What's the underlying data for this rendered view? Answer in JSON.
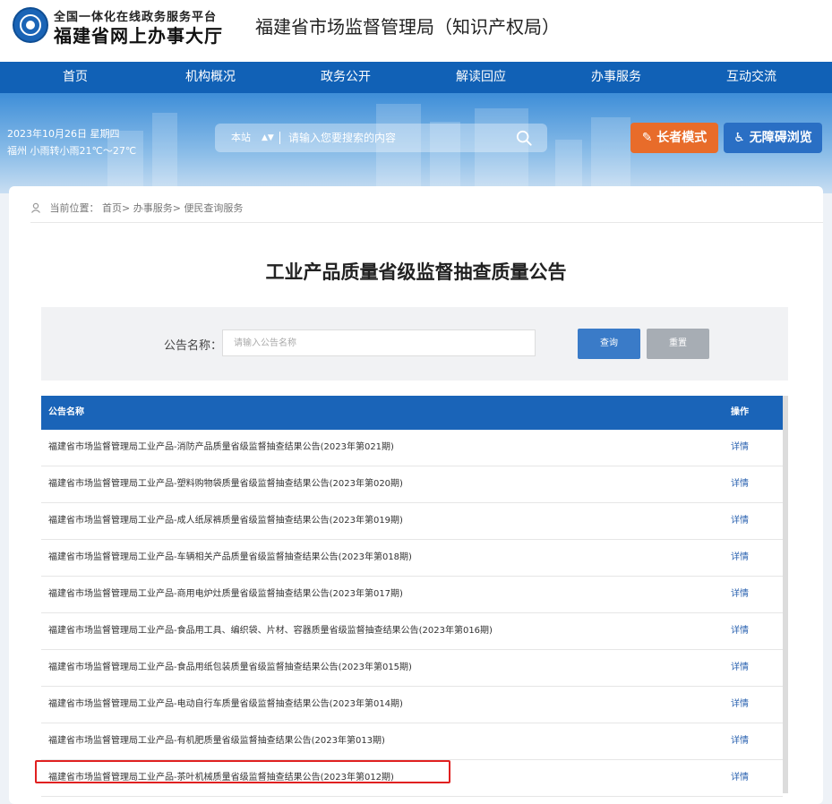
{
  "header": {
    "logo_line1": "全国一体化在线政务服务平台",
    "logo_line2": "福建省网上办事大厅",
    "site_title": "福建省市场监督管理局（知识产权局）"
  },
  "nav": {
    "items": [
      {
        "label": "首页"
      },
      {
        "label": "机构概况"
      },
      {
        "label": "政务公开"
      },
      {
        "label": "解读回应"
      },
      {
        "label": "办事服务"
      },
      {
        "label": "互动交流"
      }
    ]
  },
  "banner": {
    "date": "2023年10月26日 星期四",
    "weather": "福州 小雨转小雨21℃～27℃",
    "search_scope": "本站",
    "search_placeholder": "请输入您要搜索的内容",
    "elder_mode": "长者模式",
    "accessible": "无障碍浏览"
  },
  "breadcrumb": {
    "prefix": "当前位置：",
    "items": [
      "首页",
      "办事服务",
      "便民查询服务"
    ]
  },
  "page": {
    "title": "工业产品质量省级监督抽查质量公告",
    "filter_label": "公告名称：",
    "filter_placeholder": "请输入公告名称",
    "query_button": "查询",
    "reset_button": "重置"
  },
  "table": {
    "col_name": "公告名称",
    "col_op": "操作",
    "detail_label": "详情",
    "rows": [
      "福建省市场监督管理局工业产品-消防产品质量省级监督抽查结果公告(2023年第021期)",
      "福建省市场监督管理局工业产品-塑料购物袋质量省级监督抽查结果公告(2023年第020期)",
      "福建省市场监督管理局工业产品-成人纸尿裤质量省级监督抽查结果公告(2023年第019期)",
      "福建省市场监督管理局工业产品-车辆相关产品质量省级监督抽查结果公告(2023年第018期)",
      "福建省市场监督管理局工业产品-商用电炉灶质量省级监督抽查结果公告(2023年第017期)",
      "福建省市场监督管理局工业产品-食品用工具、编织袋、片材、容器质量省级监督抽查结果公告(2023年第016期)",
      "福建省市场监督管理局工业产品-食品用纸包装质量省级监督抽查结果公告(2023年第015期)",
      "福建省市场监督管理局工业产品-电动自行车质量省级监督抽查结果公告(2023年第014期)",
      "福建省市场监督管理局工业产品-有机肥质量省级监督抽查结果公告(2023年第013期)",
      "福建省市场监督管理局工业产品-茶叶机械质量省级监督抽查结果公告(2023年第012期)"
    ]
  },
  "colors": {
    "nav_bg": "#1161b6",
    "table_header_bg": "#1a64b8",
    "elder_btn": "#e86c2a",
    "access_btn": "#2a6fc4",
    "highlight": "#e02020"
  }
}
